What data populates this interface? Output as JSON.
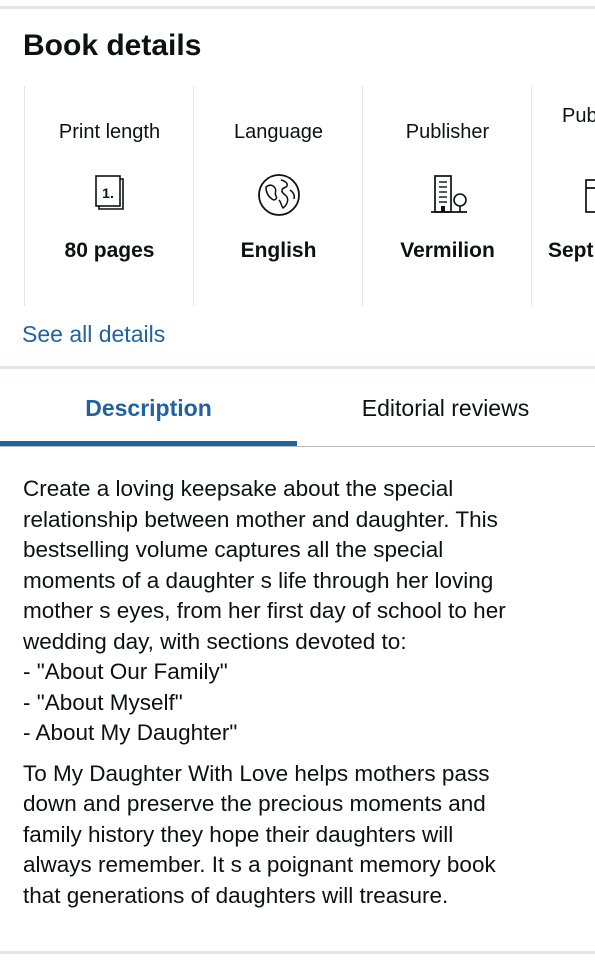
{
  "section": {
    "title": "Book details",
    "see_all": "See all details"
  },
  "details": [
    {
      "label": "Print length",
      "icon": "page-number-icon",
      "icon_text": "1.",
      "value": "80 pages"
    },
    {
      "label": "Language",
      "icon": "globe-icon",
      "value": "English"
    },
    {
      "label": "Publisher",
      "icon": "building-icon",
      "value": "Vermilion"
    },
    {
      "label": "Pub",
      "icon": "calendar-icon",
      "value": "Sept"
    }
  ],
  "tabs": [
    {
      "label": "Description",
      "active": true
    },
    {
      "label": "Editorial reviews",
      "active": false
    }
  ],
  "description": {
    "paragraph1_lines": [
      "Create a loving keepsake about the special",
      "relationship between mother and daughter. This",
      "bestselling volume captures all the special",
      "moments of a daughter  s life through her loving",
      "mother  s eyes, from her first day of school to her",
      "wedding day, with sections devoted to:",
      "- \"About Our Family\"",
      "- \"About Myself\"",
      "- About My Daughter\""
    ],
    "paragraph2_lines": [
      "To My Daughter With Love helps mothers pass",
      "down and preserve the precious moments and",
      "family history they hope their daughters will",
      "always remember. It  s a poignant memory book",
      "that generations of daughters will treasure."
    ]
  },
  "colors": {
    "link": "#2162a1",
    "text": "#0f1111",
    "divider": "#e3e6e6"
  }
}
